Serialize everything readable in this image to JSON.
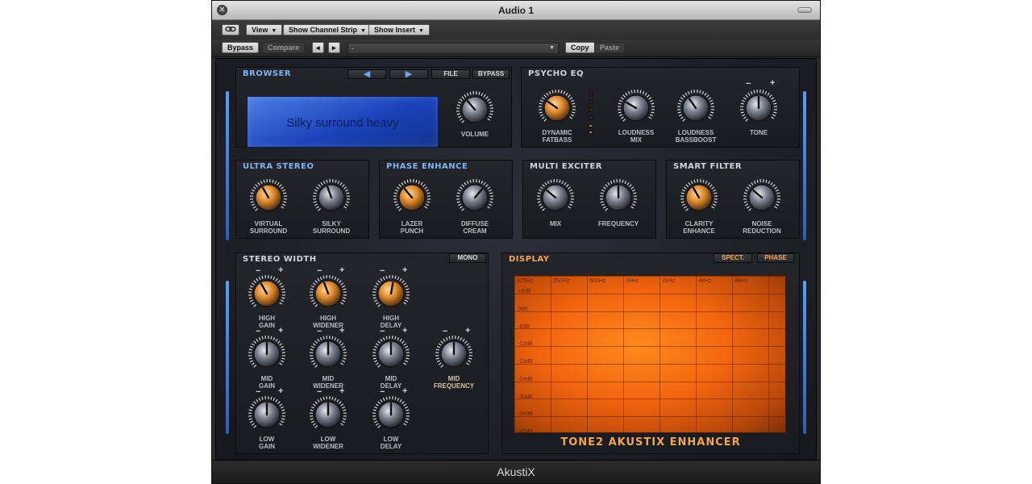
{
  "window": {
    "title": "Audio 1",
    "footer": "AkustiX"
  },
  "toolbar": {
    "link_icon": "link-icon",
    "view": "View",
    "show_channel_strip": "Show Channel Strip",
    "show_insert": "Show Insert",
    "bypass": "Bypass",
    "compare": "Compare",
    "prev": "◂",
    "next": "▸",
    "preset": "-",
    "copy": "Copy",
    "paste": "Paste"
  },
  "browser": {
    "title": "BROWSER",
    "file": "FILE",
    "bypass": "BYPASS",
    "preset_name": "Silky surround heavy",
    "volume": "VOLUME"
  },
  "psycho_eq": {
    "title": "PSYCHO EQ",
    "dynamic_fatbass": [
      "DYNAMIC",
      "FATBASS"
    ],
    "loudness_mix": [
      "LOUDNESS",
      "MIX"
    ],
    "loudness_bassboost": [
      "LOUDNESS",
      "BASSBOOST"
    ],
    "tone": "TONE"
  },
  "ultra_stereo": {
    "title": "ULTRA STEREO",
    "virtual_surround": [
      "VIRTUAL",
      "SURROUND"
    ],
    "silky_surround": [
      "SILKY",
      "SURROUND"
    ]
  },
  "phase_enhance": {
    "title": "PHASE ENHANCE",
    "lazer_punch": [
      "LAZER",
      "PUNCH"
    ],
    "diffuse_cream": [
      "DIFFUSE",
      "CREAM"
    ]
  },
  "multi_exciter": {
    "title": "MULTI EXCITER",
    "mix": "MIX",
    "frequency": "FREQUENCY"
  },
  "smart_filter": {
    "title": "SMART FILTER",
    "clarity_enhance": [
      "CLARITY",
      "ENHANCE"
    ],
    "noise_reduction": [
      "NOISE",
      "REDUCTION"
    ]
  },
  "stereo_width": {
    "title": "STEREO WIDTH",
    "mono": "MONO",
    "high_gain": [
      "HIGH",
      "GAIN"
    ],
    "high_widener": [
      "HIGH",
      "WIDENER"
    ],
    "high_delay": [
      "HIGH",
      "DELAY"
    ],
    "mid_gain": [
      "MID",
      "GAIN"
    ],
    "mid_widener": [
      "MID",
      "WIDENER"
    ],
    "mid_delay": [
      "MID",
      "DELAY"
    ],
    "mid_frequency": [
      "MID",
      "FREQUENCY"
    ],
    "low_gain": [
      "LOW",
      "GAIN"
    ],
    "low_widener": [
      "LOW",
      "WIDENER"
    ],
    "low_delay": [
      "LOW",
      "DELAY"
    ],
    "minus": "−",
    "plus": "+"
  },
  "display": {
    "title": "DISPLAY",
    "spect": "SPECT.",
    "phase": "PHASE",
    "freq_labels": [
      "125Hz",
      "250Hz",
      "500Hz",
      "1kHz",
      "2kHz",
      "4kHz",
      "8kHz"
    ],
    "db_labels": [
      "+6dB",
      "0dB",
      "-6dB",
      "-12dB",
      "-18dB",
      "-24dB",
      "-30dB",
      "-36dB",
      "-42dB"
    ],
    "brand": "TONE2 AKUSTIX ENHANCER"
  },
  "colors": {
    "accent_orange": "#f4a64a",
    "accent_blue": "#7fb2f0",
    "lcd_blue": "#2a5bd8"
  }
}
